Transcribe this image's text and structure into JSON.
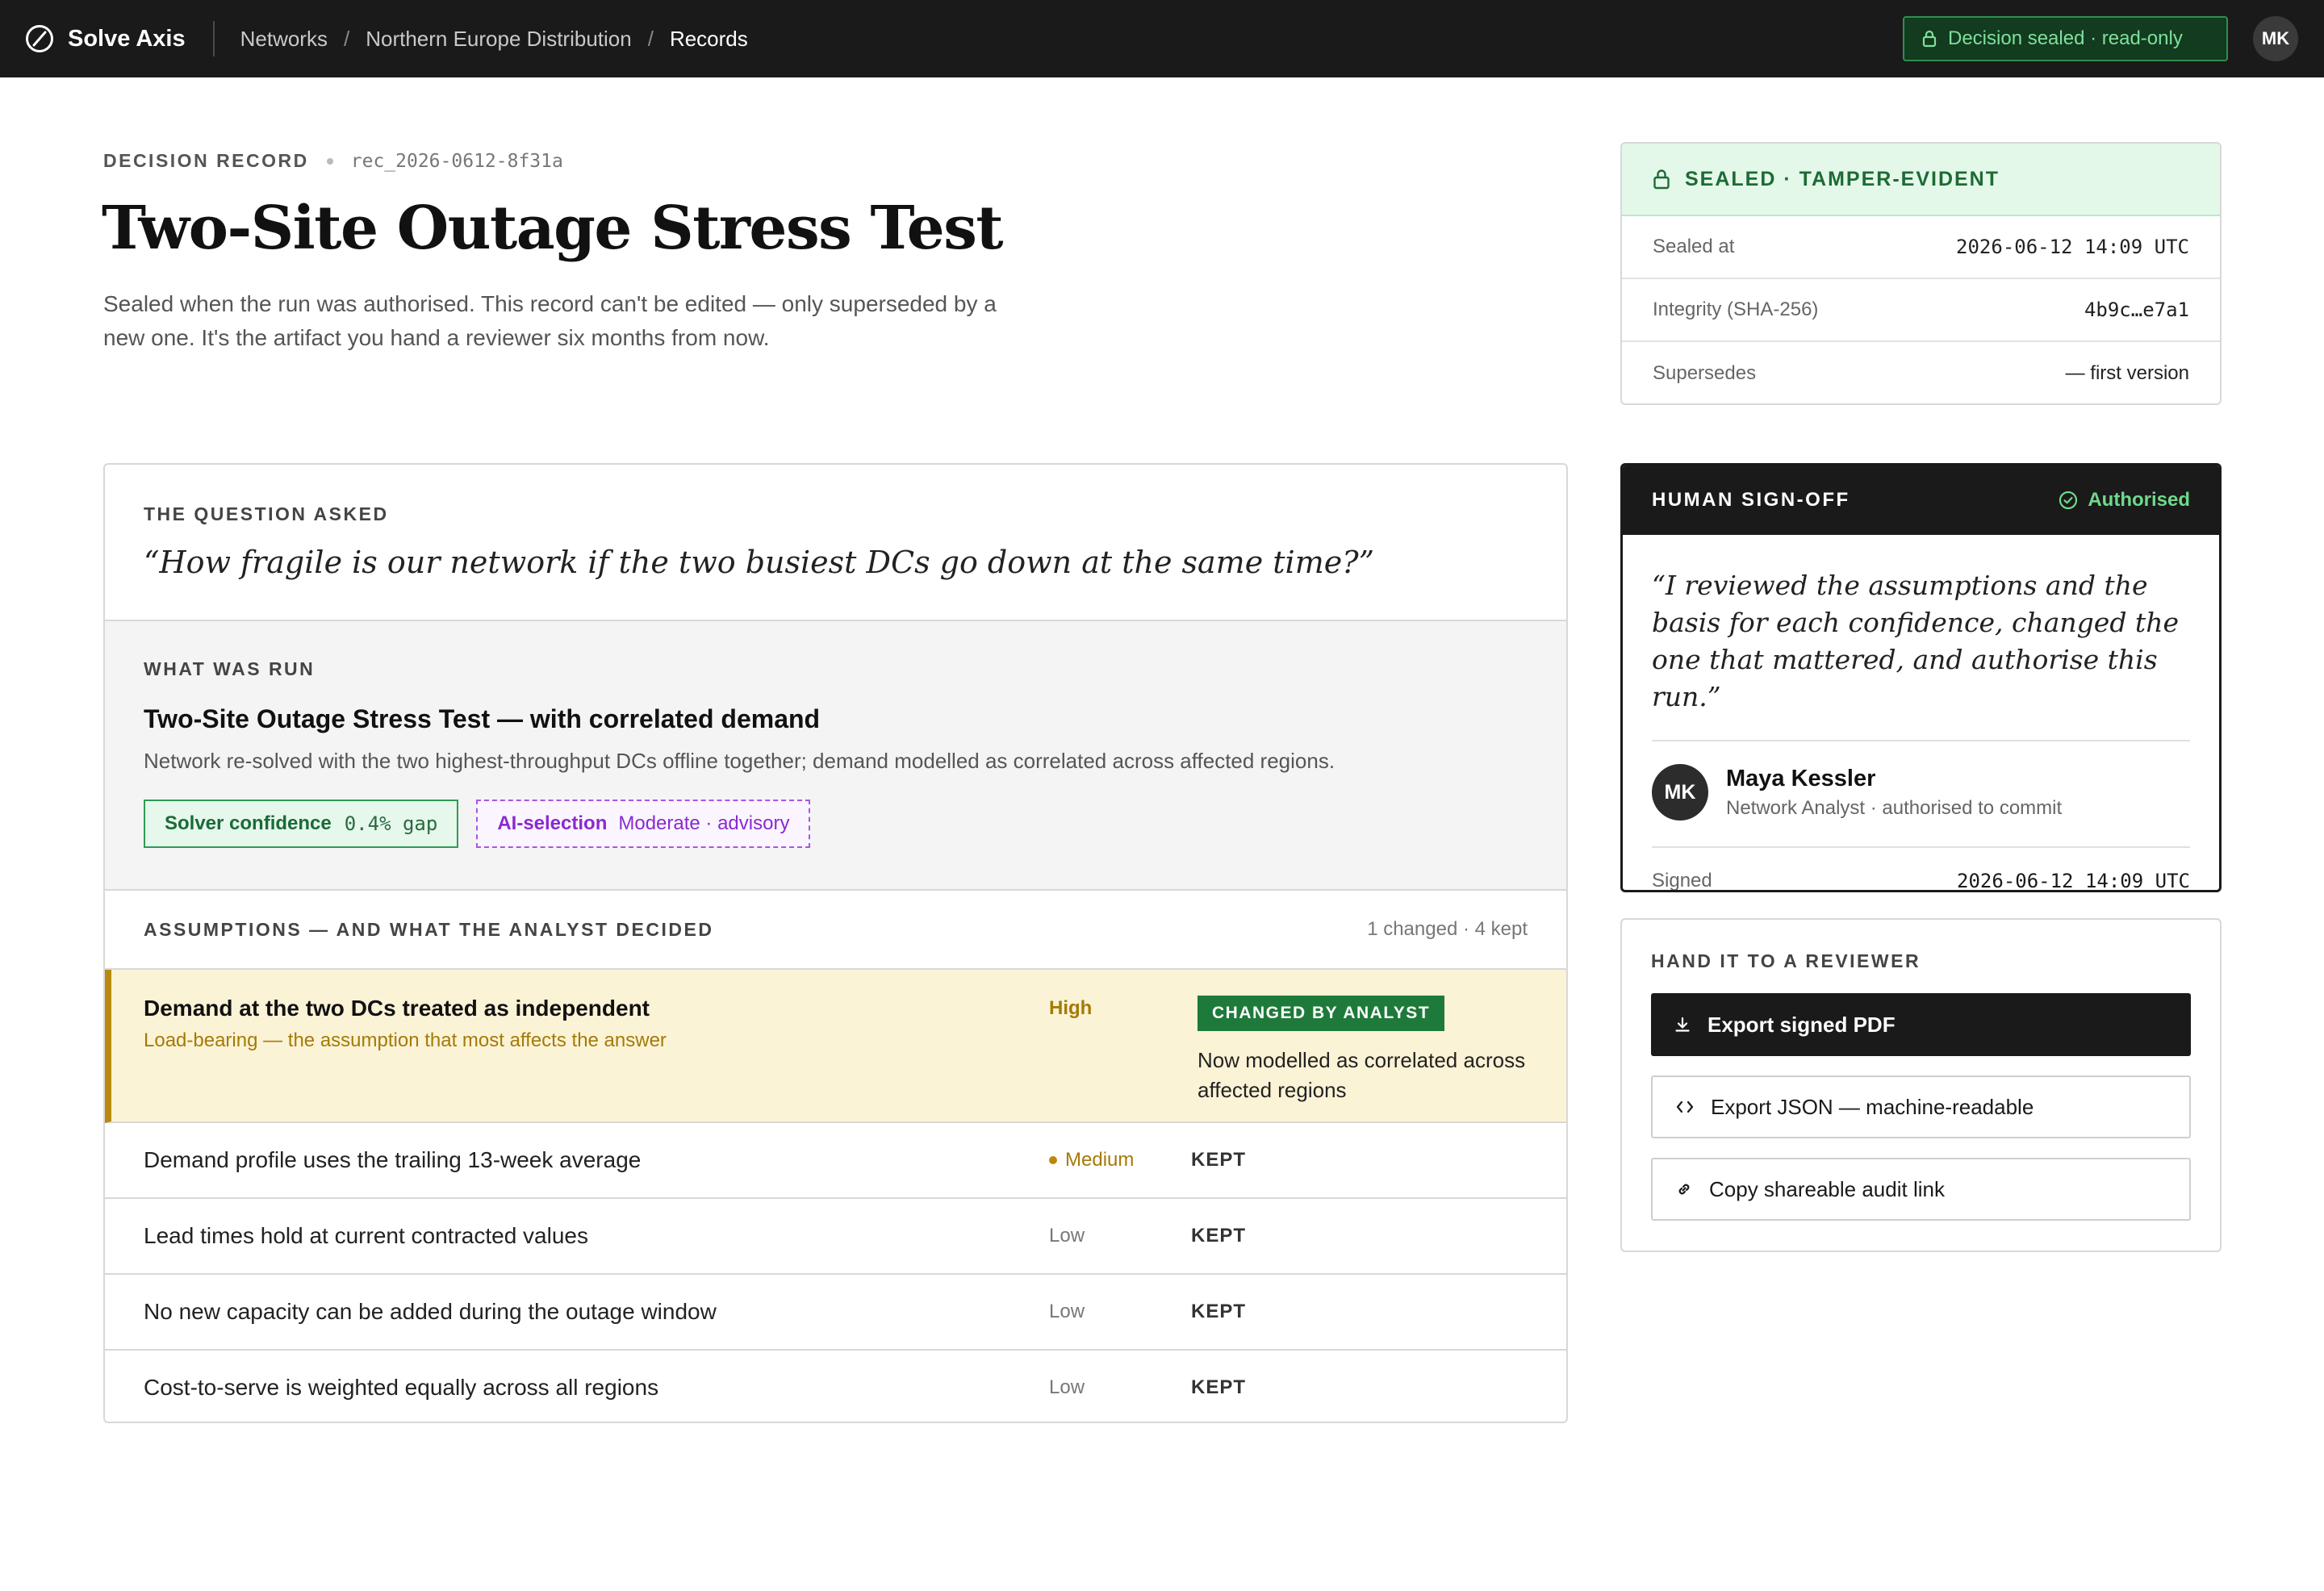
{
  "topbar": {
    "brand": "Solve Axis",
    "breadcrumbs": [
      "Networks",
      "Northern Europe Distribution",
      "Records"
    ],
    "status_pill": "Decision sealed · read-only",
    "user_initials": "MK"
  },
  "header": {
    "eyebrow": "DECISION RECORD",
    "record_id": "rec_2026-0612-8f31a",
    "title": "Two-Site Outage Stress Test",
    "description": "Sealed when the run was authorised. This record can't be edited — only superseded by a new one. It's the artifact you hand a reviewer six months from now."
  },
  "question": {
    "label": "THE QUESTION ASKED",
    "text": "“How fragile is our network if the two busiest DCs go down at the same time?”"
  },
  "run": {
    "label": "WHAT WAS RUN",
    "title": "Two-Site Outage Stress Test — with correlated demand",
    "description": "Network re-solved with the two highest-throughput DCs offline together; demand modelled as correlated across affected regions.",
    "solver_label": "Solver confidence",
    "solver_value": "0.4% gap",
    "ai_label": "AI-selection",
    "ai_value": "Moderate · advisory"
  },
  "assumptions": {
    "label": "ASSUMPTIONS — AND WHAT THE ANALYST DECIDED",
    "count": "1 changed · 4 kept",
    "changed": {
      "title": "Demand at the two DCs treated as independent",
      "subtitle": "Load-bearing — the assumption that most affects the answer",
      "confidence": "High",
      "badge": "CHANGED BY ANALYST",
      "note": "Now modelled as correlated across affected regions"
    },
    "rows": [
      {
        "text": "Demand profile uses the trailing 13-week average",
        "confidence": "Medium",
        "status": "KEPT"
      },
      {
        "text": "Lead times hold at current contracted values",
        "confidence": "Low",
        "status": "KEPT"
      },
      {
        "text": "No new capacity can be added during the outage window",
        "confidence": "Low",
        "status": "KEPT"
      },
      {
        "text": "Cost-to-serve is weighted equally across all regions",
        "confidence": "Low",
        "status": "KEPT"
      }
    ]
  },
  "seal": {
    "header": "SEALED · TAMPER-EVIDENT",
    "sealed_at_label": "Sealed at",
    "sealed_at_value": "2026-06-12 14:09 UTC",
    "integrity_label": "Integrity (SHA-256)",
    "integrity_value": "4b9c…e7a1",
    "supersedes_label": "Supersedes",
    "supersedes_value": "— first version"
  },
  "signoff": {
    "label": "HUMAN SIGN-OFF",
    "status": "Authorised",
    "quote": "“I reviewed the assumptions and the basis for each confidence, changed the one that mattered, and authorise this run.”",
    "initials": "MK",
    "name": "Maya Kessler",
    "role": "Network Analyst · authorised to commit",
    "signed_label": "Signed",
    "signed_value": "2026-06-12 14:09 UTC"
  },
  "handoff": {
    "label": "HAND IT TO A REVIEWER",
    "export_pdf": "Export signed PDF",
    "export_json": "Export JSON — machine-readable",
    "copy_link": "Copy shareable audit link"
  },
  "colors": {
    "topbar": "#1a1a1a",
    "sealed_green": "#1e7a3a",
    "changed_bg": "#fbf3d6",
    "changed_accent": "#b8890d",
    "ai_purple": "#8a2ad0"
  }
}
